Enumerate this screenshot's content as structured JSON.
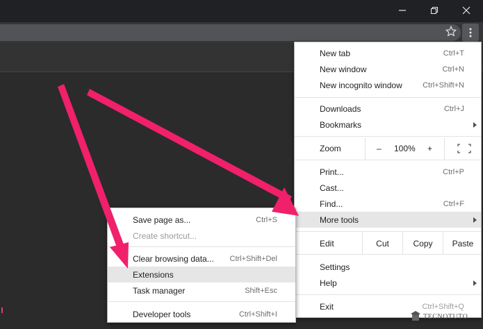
{
  "main_menu": {
    "items_group1": [
      {
        "label": "New tab",
        "shortcut": "Ctrl+T"
      },
      {
        "label": "New window",
        "shortcut": "Ctrl+N"
      },
      {
        "label": "New incognito window",
        "shortcut": "Ctrl+Shift+N"
      }
    ],
    "items_group2": [
      {
        "label": "Downloads",
        "shortcut": "Ctrl+J"
      },
      {
        "label": "Bookmarks",
        "shortcut": ""
      }
    ],
    "zoom": {
      "label": "Zoom",
      "minus": "–",
      "level": "100%",
      "plus": "+"
    },
    "items_group3": [
      {
        "label": "Print...",
        "shortcut": "Ctrl+P"
      },
      {
        "label": "Cast...",
        "shortcut": ""
      },
      {
        "label": "Find...",
        "shortcut": "Ctrl+F"
      },
      {
        "label": "More tools",
        "shortcut": ""
      }
    ],
    "edit": {
      "label": "Edit",
      "cut": "Cut",
      "copy": "Copy",
      "paste": "Paste"
    },
    "items_group4": [
      {
        "label": "Settings",
        "shortcut": ""
      },
      {
        "label": "Help",
        "shortcut": ""
      }
    ],
    "exit": {
      "label": "Exit",
      "shortcut": "Ctrl+Shift+Q"
    }
  },
  "sub_menu": {
    "group1": [
      {
        "label": "Save page as...",
        "shortcut": "Ctrl+S"
      },
      {
        "label": "Create shortcut...",
        "shortcut": ""
      }
    ],
    "group2": [
      {
        "label": "Clear browsing data...",
        "shortcut": "Ctrl+Shift+Del"
      },
      {
        "label": "Extensions",
        "shortcut": ""
      },
      {
        "label": "Task manager",
        "shortcut": "Shift+Esc"
      }
    ],
    "group3": [
      {
        "label": "Developer tools",
        "shortcut": "Ctrl+Shift+I"
      }
    ]
  },
  "watermark": {
    "text": "TECNOTUTO"
  },
  "colors": {
    "annotation_arrow": "#f0206a",
    "highlight": "#e6e6e6",
    "chrome_dark": "#202124"
  }
}
